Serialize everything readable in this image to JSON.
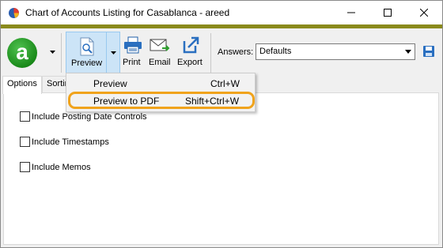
{
  "window": {
    "title": "Chart of Accounts Listing for Casablanca - areed",
    "accent_color": "#8a8a1c"
  },
  "toolbar": {
    "logo_letter": "a",
    "preview_label": "Preview",
    "print_label": "Print",
    "email_label": "Email",
    "export_label": "Export",
    "answers_label": "Answers:",
    "answers_value": "Defaults"
  },
  "tabs": [
    {
      "label": "Options"
    },
    {
      "label": "Sortin"
    }
  ],
  "options": [
    {
      "label": "Include Posting Date Controls"
    },
    {
      "label": "Include Timestamps"
    },
    {
      "label": "Include Memos"
    }
  ],
  "preview_menu": {
    "items": [
      {
        "label": "Preview",
        "shortcut": "Ctrl+W"
      },
      {
        "label": "Preview to PDF",
        "shortcut": "Shift+Ctrl+W",
        "highlighted": true
      }
    ],
    "highlight_color": "#f0a31c"
  }
}
